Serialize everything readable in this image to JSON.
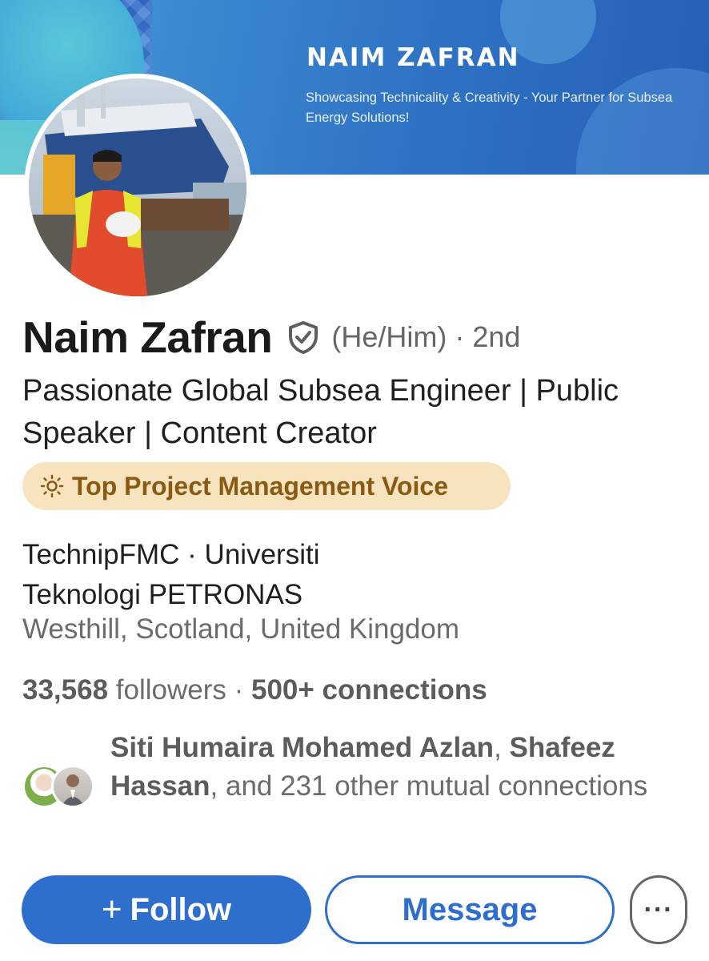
{
  "banner": {
    "title": "NAIM ZAFRAN",
    "tagline": "Showcasing Technicality & Creativity - Your Partner for Subsea Energy Solutions!"
  },
  "profile": {
    "name": "Naim Zafran",
    "verified_icon": "shield-check-icon",
    "pronouns_degree": "(He/Him) · 2nd",
    "headline": "Passionate Global Subsea Engineer | Public Speaker | Content Creator",
    "voice_badge": {
      "icon": "lightbulb-icon",
      "label": "Top Project Management Voice"
    },
    "company_education": "TechnipFMC · Universiti Teknologi PETRONAS",
    "location": "Westhill, Scotland, United Kingdom"
  },
  "stats": {
    "followers_count": "33,568",
    "followers_label": " followers · ",
    "connections": "500+ connections"
  },
  "mutual": {
    "name1": "Siti Humaira Mohamed Azlan",
    "sep1": ",",
    "name2": "Shafeez Hassan",
    "rest": ", and 231 other mutual connections"
  },
  "actions": {
    "follow_plus": "+",
    "follow_label": "Follow",
    "message_label": "Message",
    "more_label": "···"
  },
  "colors": {
    "accent": "#2e6fcd",
    "badge_bg": "#f8e3bf",
    "badge_text": "#8a5a12"
  }
}
